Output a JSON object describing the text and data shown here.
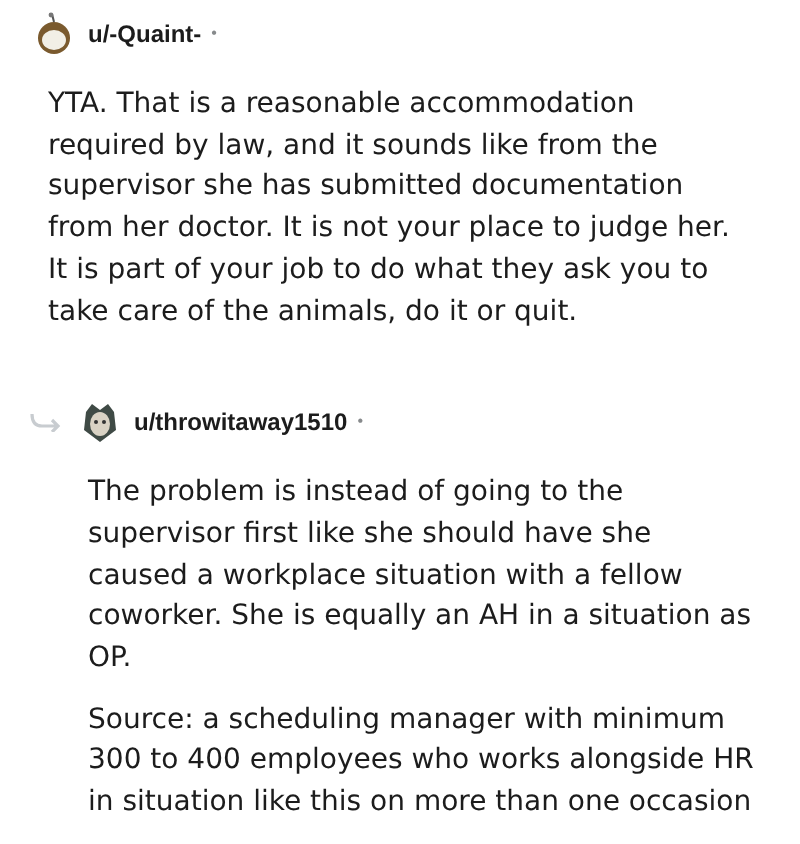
{
  "comments": [
    {
      "username": "u/-Quaint-",
      "dot": "•",
      "reply": false,
      "paragraphs": [
        "YTA. That is a reasonable accommodation required by law, and it sounds like from the supervisor she has submitted documentation from her doctor. It is not your place to judge her. It is part of your job to do what they ask you to take care of the animals, do it or quit."
      ]
    },
    {
      "username": "u/throwitaway1510",
      "dot": "•",
      "reply": true,
      "paragraphs": [
        "The problem is instead of going to the supervisor first like she should have she caused a workplace situation with a fellow coworker. She is equally an AH in a situation as OP.",
        "Source: a scheduling manager with minimum 300 to 400 employees who works alongside HR in situation like this on more than one occasion"
      ]
    }
  ]
}
